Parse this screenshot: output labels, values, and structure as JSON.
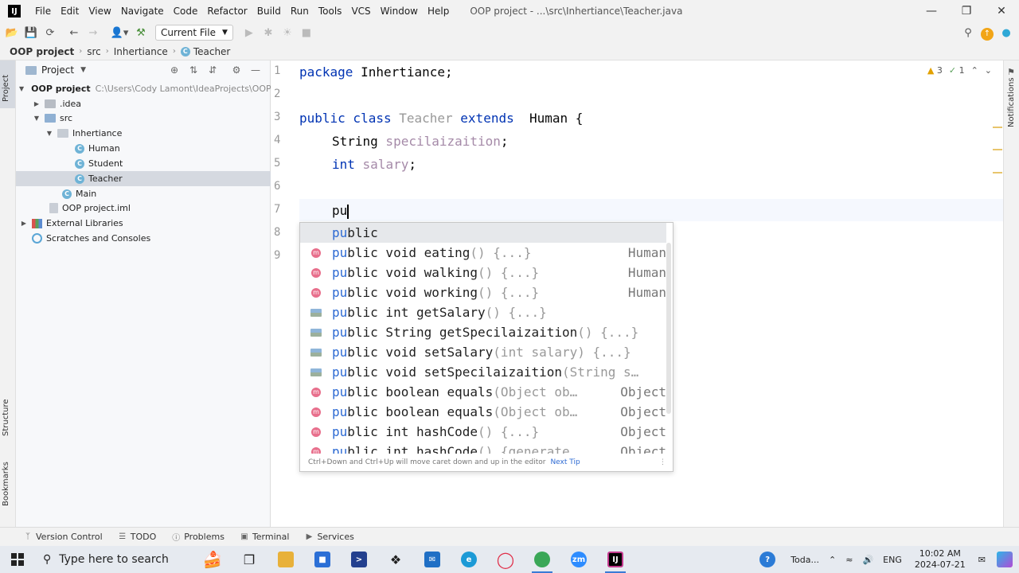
{
  "app": {
    "logo": "IJ",
    "menu": [
      "File",
      "Edit",
      "View",
      "Navigate",
      "Code",
      "Refactor",
      "Build",
      "Run",
      "Tools",
      "VCS",
      "Window",
      "Help"
    ],
    "window_title": "OOP project - ...\\src\\Inhertiance\\Teacher.java",
    "controls": [
      "minimize-icon",
      "restore-icon",
      "close-icon"
    ]
  },
  "toolbar": {
    "run_config": "Current File"
  },
  "breadcrumb": [
    "OOP project",
    "src",
    "Inhertiance",
    "Teacher"
  ],
  "project_panel": {
    "title": "Project",
    "tree": [
      {
        "label": "OOP project",
        "path": "C:\\Users\\Cody Lamont\\IdeaProjects\\OOP p",
        "type": "module",
        "expanded": true
      },
      {
        "label": ".idea",
        "type": "folder",
        "expanded": false
      },
      {
        "label": "src",
        "type": "source-folder",
        "expanded": true
      },
      {
        "label": "Inhertiance",
        "type": "package",
        "expanded": true
      },
      {
        "label": "Human",
        "type": "class"
      },
      {
        "label": "Student",
        "type": "class"
      },
      {
        "label": "Teacher",
        "type": "class",
        "selected": true
      },
      {
        "label": "Main",
        "type": "class"
      },
      {
        "label": "OOP project.iml",
        "type": "file"
      },
      {
        "label": "External Libraries",
        "type": "library",
        "expanded": false
      },
      {
        "label": "Scratches and Consoles",
        "type": "scratches"
      }
    ]
  },
  "left_stripe": {
    "project": "Project",
    "structure": "Structure",
    "bookmarks": "Bookmarks"
  },
  "right_stripe": {
    "notifications": "Notifications"
  },
  "editor": {
    "line_numbers": [
      "1",
      "2",
      "3",
      "4",
      "5",
      "6",
      "7",
      "8",
      "9"
    ],
    "inspections": {
      "warnings": "3",
      "checks": "1"
    },
    "lines": {
      "l1_kw": "package",
      "l1_rest": " Inhertiance;",
      "l3_kw1": "public class",
      "l3_name": " Teacher",
      "l3_kw2": " extends",
      "l3_rest": "  Human {",
      "l4_type": "String",
      "l4_field": " specilaizaition",
      "l4_end": ";",
      "l5_type": "int",
      "l5_field": " salary",
      "l5_end": ";",
      "l7_typed": "pu"
    }
  },
  "completion": {
    "items": [
      {
        "match": "pu",
        "rest": "blic",
        "tail": "",
        "type": "",
        "icon": "keyword"
      },
      {
        "match": "pu",
        "rest": "blic void eating",
        "tail": "() {...}",
        "type": "Human",
        "icon": "method-icon"
      },
      {
        "match": "pu",
        "rest": "blic void walking",
        "tail": "() {...}",
        "type": "Human",
        "icon": "method-icon"
      },
      {
        "match": "pu",
        "rest": "blic void working",
        "tail": "() {...}",
        "type": "Human",
        "icon": "method-icon"
      },
      {
        "match": "pu",
        "rest": "blic int getSalary",
        "tail": "() {...}",
        "type": "",
        "icon": "property-icon"
      },
      {
        "match": "pu",
        "rest": "blic String getSpecilaizaition",
        "tail": "() {...}",
        "type": "",
        "icon": "property-icon"
      },
      {
        "match": "pu",
        "rest": "blic void setSalary",
        "tail": "(int salary) {...}",
        "type": "",
        "icon": "property-icon"
      },
      {
        "match": "pu",
        "rest": "blic void setSpecilaizaition",
        "tail": "(String s…",
        "type": "",
        "icon": "property-icon"
      },
      {
        "match": "pu",
        "rest": "blic boolean equals",
        "tail": "(Object ob…",
        "type": "Object",
        "icon": "method-icon"
      },
      {
        "match": "pu",
        "rest": "blic boolean equals",
        "tail": "(Object ob…",
        "type": "Object",
        "icon": "method-icon"
      },
      {
        "match": "pu",
        "rest": "blic int hashCode",
        "tail": "() {...}",
        "type": "Object",
        "icon": "method-icon"
      },
      {
        "match": "pu",
        "rest": "blic int hashCode",
        "tail": "() {generate…",
        "type": "Object",
        "icon": "method-icon"
      }
    ],
    "footer_text": "Ctrl+Down and Ctrl+Up will move caret down and up in the editor",
    "footer_tip": "Next Tip"
  },
  "bottom_bar": [
    "Version Control",
    "TODO",
    "Problems",
    "Terminal",
    "Services"
  ],
  "taskbar": {
    "search_placeholder": "Type here to search",
    "weather": "Toda...",
    "language": "ENG",
    "time": "10:02 AM",
    "date": "2024-07-21"
  }
}
